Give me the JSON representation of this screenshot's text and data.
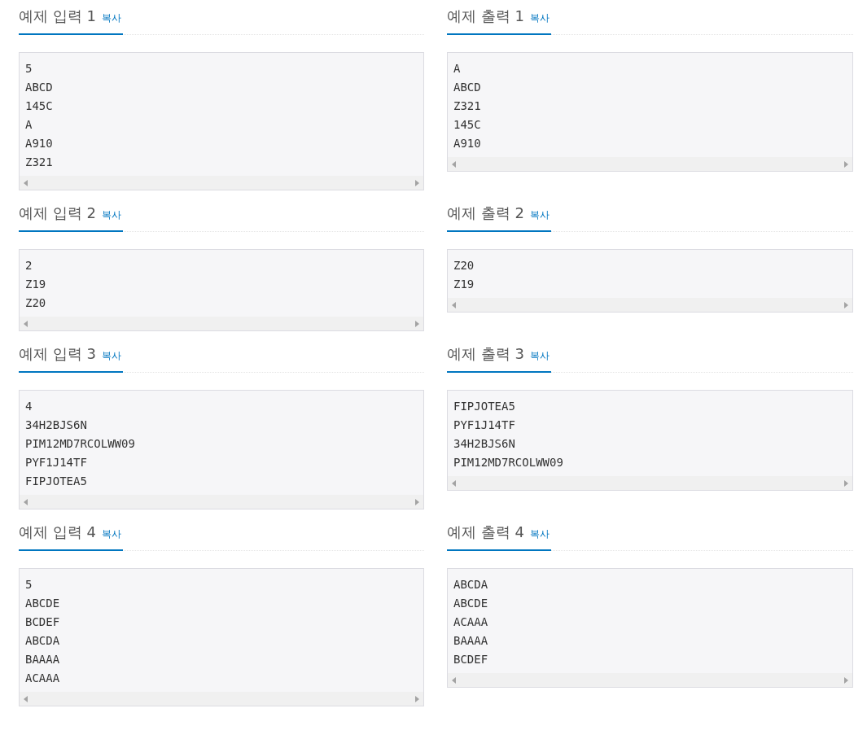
{
  "samples": [
    {
      "input": {
        "title": "예제 입력 1",
        "copy": "복사",
        "lines": [
          "5",
          "ABCD",
          "145C",
          "A",
          "A910",
          "Z321"
        ]
      },
      "output": {
        "title": "예제 출력 1",
        "copy": "복사",
        "lines": [
          "A",
          "ABCD",
          "Z321",
          "145C",
          "A910"
        ]
      }
    },
    {
      "input": {
        "title": "예제 입력 2",
        "copy": "복사",
        "lines": [
          "2",
          "Z19",
          "Z20"
        ]
      },
      "output": {
        "title": "예제 출력 2",
        "copy": "복사",
        "lines": [
          "Z20",
          "Z19"
        ]
      }
    },
    {
      "input": {
        "title": "예제 입력 3",
        "copy": "복사",
        "lines": [
          "4",
          "34H2BJS6N",
          "PIM12MD7RCOLWW09",
          "PYF1J14TF",
          "FIPJOTEA5"
        ]
      },
      "output": {
        "title": "예제 출력 3",
        "copy": "복사",
        "lines": [
          "FIPJOTEA5",
          "PYF1J14TF",
          "34H2BJS6N",
          "PIM12MD7RCOLWW09"
        ]
      }
    },
    {
      "input": {
        "title": "예제 입력 4",
        "copy": "복사",
        "lines": [
          "5",
          "ABCDE",
          "BCDEF",
          "ABCDA",
          "BAAAA",
          "ACAAA"
        ]
      },
      "output": {
        "title": "예제 출력 4",
        "copy": "복사",
        "lines": [
          "ABCDA",
          "ABCDE",
          "ACAAA",
          "BAAAA",
          "BCDEF"
        ]
      }
    }
  ]
}
